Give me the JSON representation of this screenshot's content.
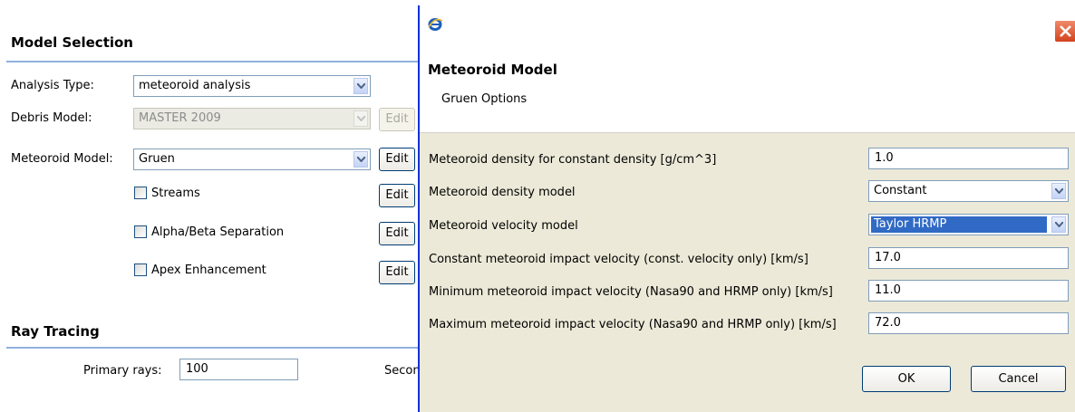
{
  "background": {
    "model_selection": {
      "title": "Model Selection",
      "analysis_type": {
        "label": "Analysis Type:",
        "value": "meteoroid analysis"
      },
      "debris_model": {
        "label": "Debris Model:",
        "value": "MASTER 2009",
        "edit_label": "Edit"
      },
      "meteoroid_model": {
        "label": "Meteoroid Model:",
        "value": "Gruen",
        "edit_label": "Edit"
      },
      "options": [
        {
          "label": "Streams",
          "checked": false,
          "edit_label": "Edit"
        },
        {
          "label": "Alpha/Beta Separation",
          "checked": false,
          "edit_label": "Edit"
        },
        {
          "label": "Apex Enhancement",
          "checked": false,
          "edit_label": "Edit"
        }
      ]
    },
    "ray_tracing": {
      "title": "Ray Tracing",
      "primary_rays": {
        "label": "Primary rays:",
        "value": "100"
      },
      "secondary_partial": "Secon"
    }
  },
  "dialog": {
    "title": "Meteoroid Model",
    "subtitle": "Gruen Options",
    "rows": [
      {
        "label": "Meteoroid density for constant density [g/cm^3]",
        "value": "1.0",
        "kind": "text"
      },
      {
        "label": "Meteoroid density model",
        "value": "Constant",
        "kind": "combo"
      },
      {
        "label": "Meteoroid velocity model",
        "value": "Taylor HRMP",
        "kind": "combo"
      },
      {
        "label": "Constant meteoroid impact velocity (const. velocity only) [km/s]",
        "value": "17.0",
        "kind": "text"
      },
      {
        "label": "Minimum meteoroid impact velocity (Nasa90 and HRMP only) [km/s]",
        "value": "11.0",
        "kind": "text"
      },
      {
        "label": "Maximum meteoroid impact velocity (Nasa90 and HRMP only) [km/s]",
        "value": "72.0",
        "kind": "text"
      }
    ],
    "ok_label": "OK",
    "cancel_label": "Cancel"
  },
  "colors": {
    "accent_line": "#8fb1dd",
    "dialog_bg": "#ece9d8",
    "selection": "#316ac5",
    "close_button": "#e0542b"
  }
}
